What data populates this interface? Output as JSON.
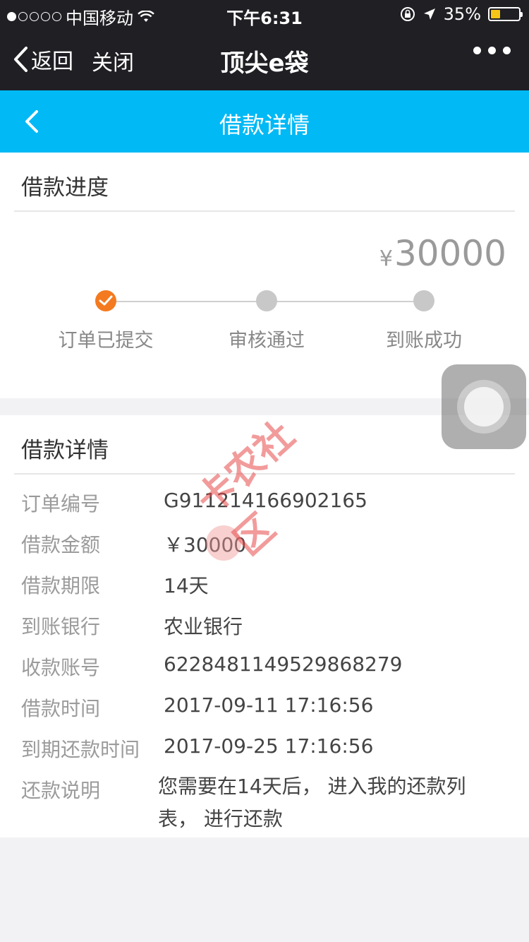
{
  "status_bar": {
    "carrier": "中国移动",
    "time": "下午6:31",
    "battery": "35%",
    "battery_level": 0.35
  },
  "wechat_nav": {
    "back_label": "返回",
    "close_label": "关闭",
    "title": "顶尖e袋"
  },
  "header": {
    "title": "借款详情"
  },
  "progress": {
    "section_title": "借款进度",
    "currency": "¥",
    "amount": "30000",
    "steps": [
      {
        "label": "订单已提交",
        "done": true
      },
      {
        "label": "审核通过",
        "done": false
      },
      {
        "label": "到账成功",
        "done": false
      }
    ]
  },
  "details": {
    "section_title": "借款详情",
    "rows": [
      {
        "label": "订单编号",
        "value": "G911214166902165"
      },
      {
        "label": "借款金额",
        "value": "￥30000"
      },
      {
        "label": "借款期限",
        "value": "14天"
      },
      {
        "label": "到账银行",
        "value": "农业银行"
      },
      {
        "label": "收款账号",
        "value": "6228481149529868279"
      },
      {
        "label": "借款时间",
        "value": "2017-09-11 17:16:56"
      },
      {
        "label": "到期还款时间",
        "value": "2017-09-25 17:16:56"
      }
    ],
    "repay_label": "还款说明",
    "repay_note": "您需要在14天后， 进入我的还款列表， 进行还款"
  },
  "watermark": "卡农社区",
  "colors": {
    "header_blue": "#00b9f5",
    "step_done": "#f47a20",
    "step_pending": "#c8c8c8"
  }
}
